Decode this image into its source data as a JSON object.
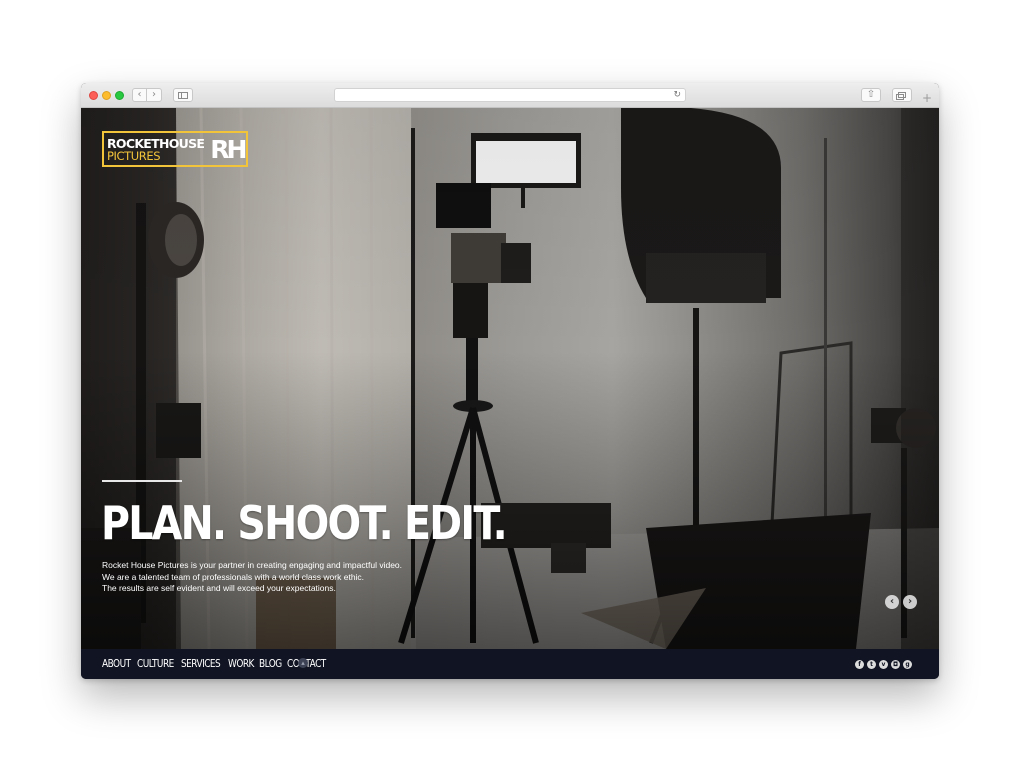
{
  "browser": {
    "address_url": "",
    "reload_icon": "reload-icon",
    "new_tab_icon": "plus-icon"
  },
  "brand": {
    "line1": "ROCKETHOUSE",
    "line2": "PICTURES",
    "mark": "RH",
    "accent_color": "#f2c43a"
  },
  "hero": {
    "title": "PLAN. SHOOT. EDIT.",
    "body_lines": [
      "Rocket House Pictures is your partner in creating engaging and impactful video.",
      "We are a talented team of professionals with a world class work ethic.",
      "The results are self evident and will exceed your expectations."
    ],
    "background_image": "film studio with camera on tripod, lights and director's chair"
  },
  "slider": {
    "prev_icon": "chevron-left-icon",
    "next_icon": "chevron-right-icon"
  },
  "nav": {
    "items": [
      {
        "label": "ABOUT"
      },
      {
        "label": "CULTURE"
      },
      {
        "label": "SERVICES"
      },
      {
        "label": "WORK"
      },
      {
        "label": "BLOG"
      },
      {
        "label": "CONTACT"
      }
    ],
    "background_color": "#101423"
  },
  "social": {
    "icons": [
      {
        "name": "facebook-icon",
        "glyph": "f"
      },
      {
        "name": "twitter-icon",
        "glyph": "t"
      },
      {
        "name": "vimeo-icon",
        "glyph": "v"
      },
      {
        "name": "instagram-icon",
        "glyph": "◘"
      },
      {
        "name": "google-plus-icon",
        "glyph": "g"
      }
    ]
  }
}
